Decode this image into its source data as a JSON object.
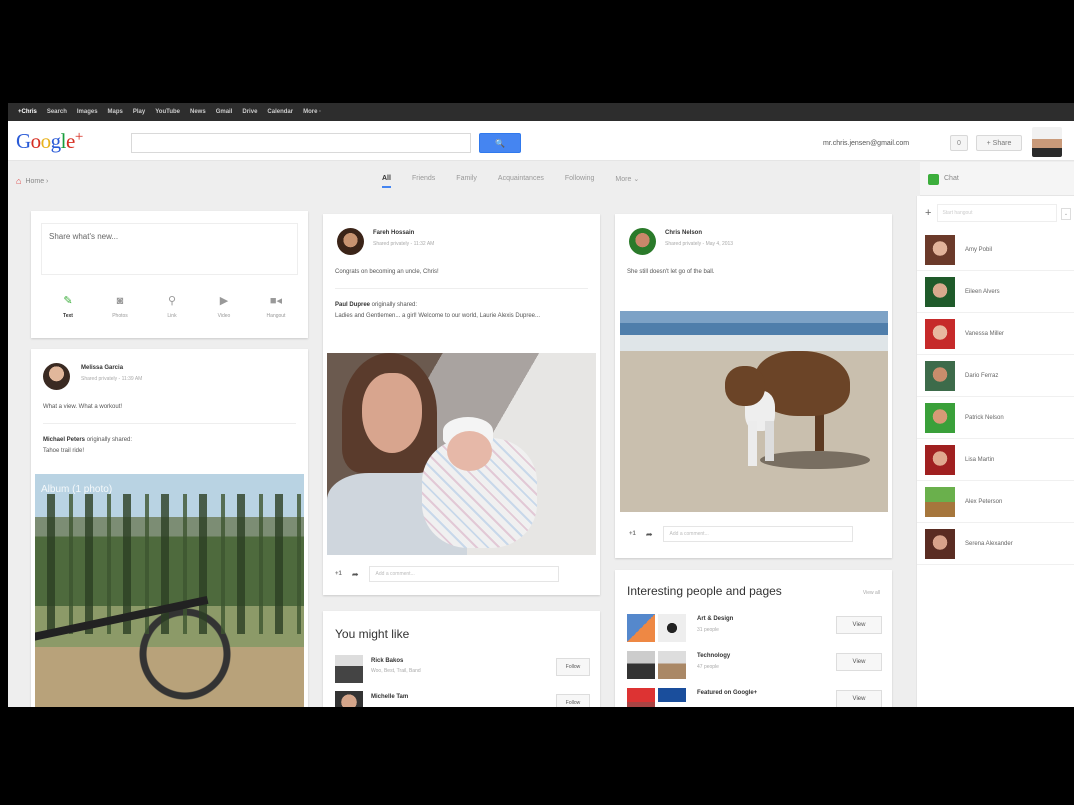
{
  "gbar": [
    "+Chris",
    "Search",
    "Images",
    "Maps",
    "Play",
    "YouTube",
    "News",
    "Gmail",
    "Drive",
    "Calendar",
    "More ·"
  ],
  "header": {
    "logo": {
      "g1": "G",
      "o1": "o",
      "o2": "o",
      "g2": "g",
      "l": "l",
      "e": "e",
      "plus": "+"
    },
    "search_icon": "🔍",
    "email": "mr.chris.jensen@gmail.com",
    "notif_count": "0",
    "share_label": "+ Share"
  },
  "nav": {
    "home_label": "Home ›",
    "tabs": [
      "All",
      "Friends",
      "Family",
      "Acquaintances",
      "Following",
      "More ⌄"
    ]
  },
  "chat": {
    "label": "Chat",
    "hangout_placeholder": "Start hangout",
    "more": "⌄",
    "contacts": [
      "Amy Pobil",
      "Eileen Alvers",
      "Vanessa Miller",
      "Dario Ferraz",
      "Patrick Nelson",
      "Lisa Martin",
      "Alex Peterson",
      "Serena Alexander"
    ]
  },
  "share": {
    "placeholder": "Share what's new...",
    "options": [
      {
        "icon": "✎",
        "label": "Text"
      },
      {
        "icon": "◙",
        "label": "Photos"
      },
      {
        "icon": "⚲",
        "label": "Link"
      },
      {
        "icon": "▶",
        "label": "Video"
      },
      {
        "icon": "■◂",
        "label": "Hangout"
      }
    ]
  },
  "posts": {
    "melissa": {
      "name": "Melissa Garcia",
      "meta": "Shared privately  -  11:39 AM",
      "text": "What a view.  What a workout!",
      "shared_by": "Michael Peters",
      "shared_suffix": " originally shared:",
      "shared_text": "Tahoe trail ride!",
      "album": "Album  (1 photo)"
    },
    "fareh": {
      "name": "Fareh Hossain",
      "meta": "Shared privately  -  11:32 AM",
      "text": "Congrats on becoming an uncle, Chris!",
      "shared_by": "Paul Dupree",
      "shared_suffix": " originally shared:",
      "shared_text": "Ladies and Gentlemen... a girl! Welcome to our world, Laurie Alexis Dupree...",
      "plus": "+1",
      "reshare": "➦",
      "comment": "Add a comment..."
    },
    "chris": {
      "name": "Chris Nelson",
      "meta": "Shared privately  -  May 4, 2013",
      "text": "She still doesn't let go of the ball.",
      "plus": "+1",
      "reshare": "➦",
      "comment": "Add a comment..."
    }
  },
  "you_might_like": {
    "title": "You might like",
    "people": [
      {
        "name": "Rick Bakos",
        "sub": "Woo, Best, Trail, Band",
        "action": "Follow"
      },
      {
        "name": "Michelle Tam",
        "sub": "",
        "action": "Follow"
      }
    ]
  },
  "interesting": {
    "title": "Interesting people and pages",
    "view_all": "View all",
    "pages": [
      {
        "name": "Art & Design",
        "sub": "31 people",
        "action": "View"
      },
      {
        "name": "Technology",
        "sub": "47 people",
        "action": "View"
      },
      {
        "name": "Featured on Google+",
        "sub": "",
        "action": "View"
      }
    ]
  }
}
